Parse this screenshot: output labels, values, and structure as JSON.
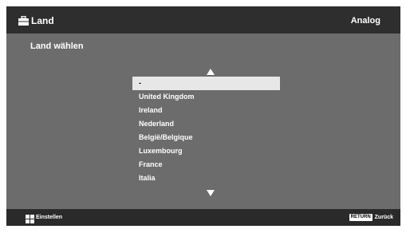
{
  "header": {
    "title": "Land",
    "title_icon": "toolbox-icon",
    "right_label": "Analog"
  },
  "page": {
    "title": "Land wählen"
  },
  "list": {
    "scroll_up_icon": "triangle-up-icon",
    "scroll_down_icon": "triangle-down-icon",
    "selected_index": 0,
    "items": [
      {
        "label": "-"
      },
      {
        "label": "United Kingdom"
      },
      {
        "label": "Ireland"
      },
      {
        "label": "Nederland"
      },
      {
        "label": "België/Belgique"
      },
      {
        "label": "Luxembourg"
      },
      {
        "label": "France"
      },
      {
        "label": "Italia"
      }
    ]
  },
  "footer": {
    "left_icon": "dpad-icon",
    "left_label": "Einstellen",
    "return_key": "RETURN",
    "right_label": "Zurück"
  },
  "colors": {
    "background": "#6c6c6c",
    "header": "#2e2e2e",
    "footer": "#2a2a2a",
    "selection": "#e7e7e7",
    "text": "#ffffff"
  }
}
